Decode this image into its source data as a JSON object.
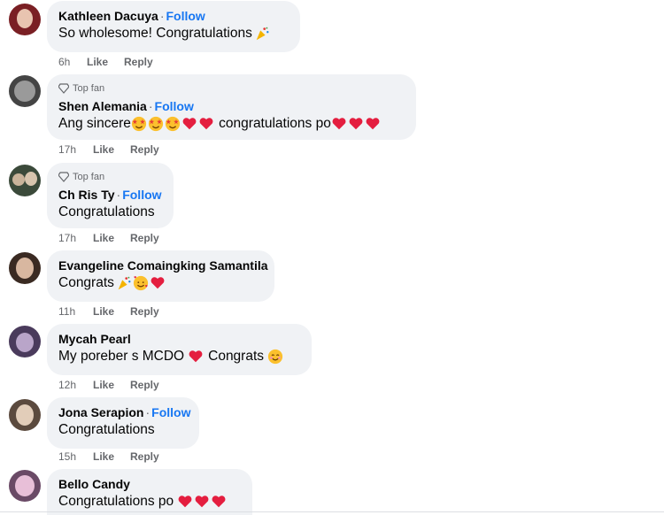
{
  "comments": [
    {
      "name": "Kathleen Dacuya",
      "follow": "Follow",
      "top_fan": false,
      "text": "So wholesome! Congratulations",
      "emojis": [
        "party-popper"
      ],
      "time": "6h",
      "like": "Like",
      "reply": "Reply",
      "avatar_colors": [
        "#7a1f24",
        "#e8c4b0"
      ]
    },
    {
      "top_fan_label": "Top fan",
      "name": "Shen Alemania",
      "follow": "Follow",
      "top_fan": true,
      "text": "Ang sincere",
      "emojis_after_first": [
        "star-struck",
        "star-struck",
        "star-struck",
        "red-heart",
        "red-heart"
      ],
      "text2": " congratulations po",
      "emojis": [
        "red-heart",
        "red-heart",
        "red-heart"
      ],
      "time": "17h",
      "like": "Like",
      "reply": "Reply",
      "avatar_colors": [
        "#444444",
        "#9a9a9a"
      ]
    },
    {
      "top_fan_label": "Top fan",
      "name": "Ch Ris Ty",
      "follow": "Follow",
      "top_fan": true,
      "text": "Congratulations",
      "emojis": [],
      "time": "17h",
      "like": "Like",
      "reply": "Reply",
      "avatar_colors": [
        "#3b4a3a",
        "#c9b39a"
      ]
    },
    {
      "name": "Evangeline Comaingking Samantila",
      "follow": "",
      "top_fan": false,
      "text": "Congrats",
      "emojis": [
        "party-popper",
        "smiling-face-with-hearts",
        "red-heart"
      ],
      "time": "11h",
      "like": "Like",
      "reply": "Reply",
      "avatar_colors": [
        "#3a2a22",
        "#d8b7a0"
      ]
    },
    {
      "name": "Mycah Pearl",
      "follow": "",
      "top_fan": false,
      "text": "My poreber s MCDO",
      "emojis_mid": [
        "red-heart"
      ],
      "text2": "Congrats",
      "emojis": [
        "smiling-face"
      ],
      "time": "12h",
      "like": "Like",
      "reply": "Reply",
      "avatar_colors": [
        "#4a3b5c",
        "#b9a5c9"
      ]
    },
    {
      "name": "Jona Serapion",
      "follow": "Follow",
      "top_fan": false,
      "text": "Congratulations",
      "emojis": [],
      "time": "15h",
      "like": "Like",
      "reply": "Reply",
      "avatar_colors": [
        "#5b4a3e",
        "#e2cdb9"
      ]
    },
    {
      "name": "Bello Candy",
      "follow": "",
      "top_fan": false,
      "text": "Congratulations po",
      "emojis": [
        "red-heart",
        "red-heart",
        "red-heart"
      ],
      "avatar_colors": [
        "#6a4a66",
        "#e8bfd8"
      ]
    }
  ],
  "colors": {
    "follow": "#1877f2",
    "bubble": "#f0f2f5",
    "meta": "#65676b"
  }
}
